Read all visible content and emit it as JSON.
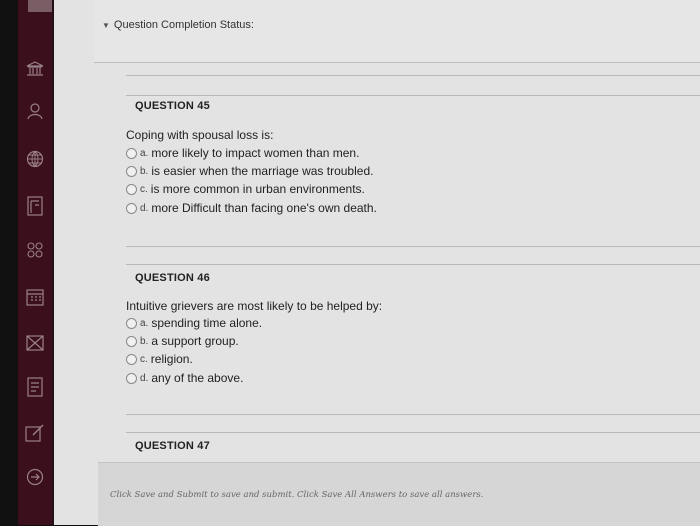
{
  "status": {
    "label": "Question Completion Status:",
    "icon": "chevron-down-icon"
  },
  "sidebar": {
    "icons": [
      "institution-icon",
      "user-icon",
      "globe-icon",
      "grades-icon",
      "groups-icon",
      "calendar-icon",
      "messages-icon",
      "notes-icon",
      "edit-icon",
      "logout-icon"
    ]
  },
  "questions": [
    {
      "header": "QUESTION 45",
      "text": "Coping with spousal loss is:",
      "choices": [
        {
          "letter": "a.",
          "text": "more likely to impact women than men."
        },
        {
          "letter": "b.",
          "text": "is easier when the marriage was troubled."
        },
        {
          "letter": "c.",
          "text": "is more common in urban environments."
        },
        {
          "letter": "d.",
          "text": "more Difficult than facing one's own death."
        }
      ]
    },
    {
      "header": "QUESTION 46",
      "text": "Intuitive grievers are most likely to be helped by:",
      "choices": [
        {
          "letter": "a.",
          "text": "spending time alone."
        },
        {
          "letter": "b.",
          "text": "a support group."
        },
        {
          "letter": "c.",
          "text": "religion."
        },
        {
          "letter": "d.",
          "text": "any of the above."
        }
      ]
    },
    {
      "header": "QUESTION 47"
    }
  ],
  "footer": {
    "text": "Click Save and Submit to save and submit. Click Save All Answers to save all answers."
  }
}
